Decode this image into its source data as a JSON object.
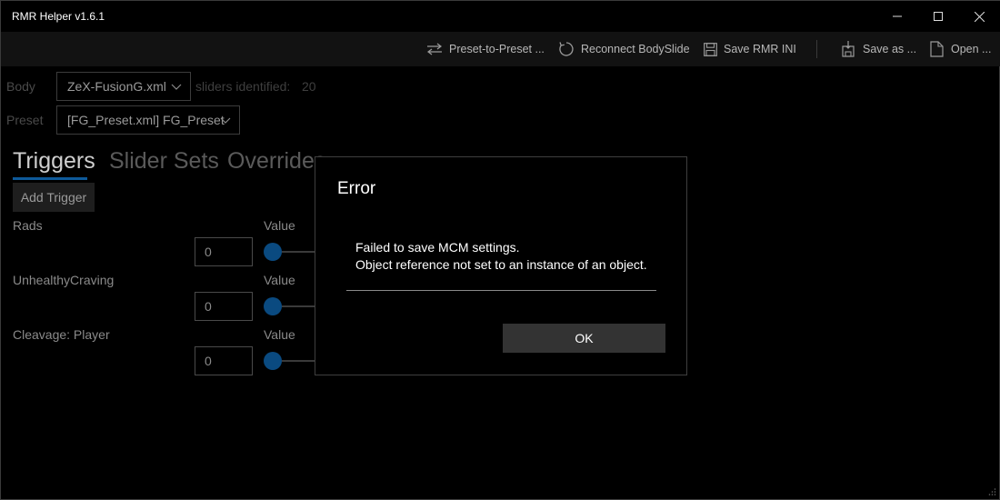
{
  "window": {
    "title": "RMR Helper v1.6.1"
  },
  "toolbar": {
    "preset_to_preset": "Preset-to-Preset ...",
    "reconnect": "Reconnect BodySlide",
    "save_ini": "Save RMR INI",
    "save_as": "Save as ...",
    "open": "Open ..."
  },
  "form": {
    "body_label": "Body",
    "body_value": "ZeX-FusionG.xml",
    "sliders_label": "sliders identified:",
    "sliders_count": "20",
    "preset_label": "Preset",
    "preset_value": "[FG_Preset.xml] FG_Preset"
  },
  "tabs": [
    "Triggers",
    "Slider Sets",
    "Overrides"
  ],
  "add_trigger_label": "Add Trigger",
  "triggers": [
    {
      "name": "Rads",
      "value_label": "Value",
      "value": "0"
    },
    {
      "name": "UnhealthyCraving",
      "value_label": "Value",
      "value": "0"
    },
    {
      "name": "Cleavage: Player",
      "value_label": "Value",
      "value": "0"
    }
  ],
  "dialog": {
    "title": "Error",
    "line1": "Failed to save MCM settings.",
    "line2": "Object reference not set to an instance of an object.",
    "ok_label": "OK"
  },
  "icons": {
    "minimize": "minimize-icon",
    "maximize": "maximize-icon",
    "close": "close-icon",
    "swap": "swap-arrows-icon",
    "refresh": "refresh-icon",
    "save": "floppy-disk-icon",
    "save_as": "save-as-icon",
    "open": "document-icon",
    "chevron": "chevron-down-icon"
  },
  "colors": {
    "accent": "#0e5a9a",
    "background": "#000000",
    "toolbar": "#121212"
  }
}
